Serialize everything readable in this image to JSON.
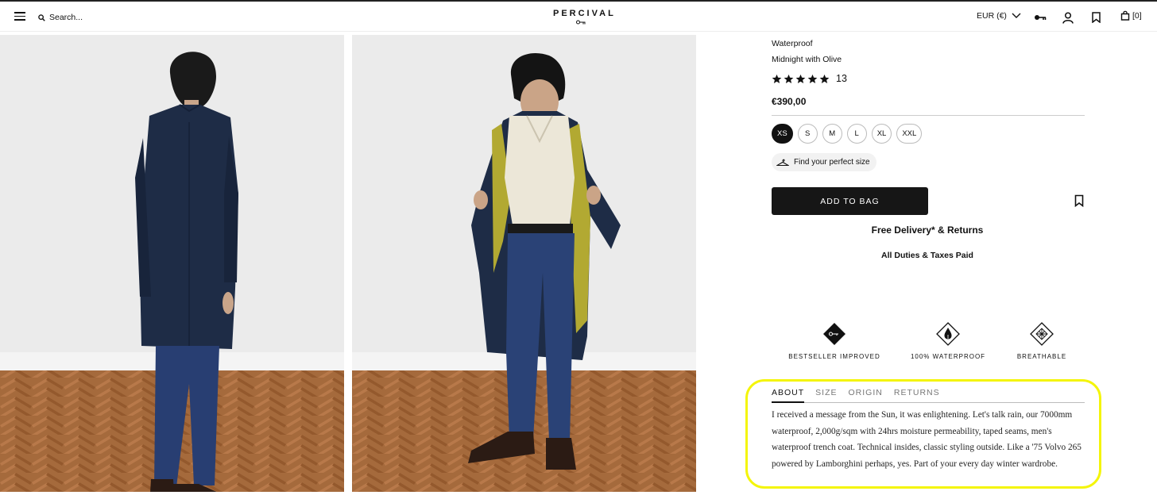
{
  "header": {
    "search_placeholder": "Search...",
    "logo_text": "PERCIVAL",
    "currency": "EUR (€)",
    "bag_count": "[0]",
    "icons": [
      "menu-icon",
      "search-icon",
      "chevron-down-icon",
      "key-icon",
      "account-icon",
      "bookmark-icon",
      "bag-icon"
    ]
  },
  "product": {
    "feature_line": "Waterproof",
    "colour": "Midnight with Olive",
    "rating": 5,
    "review_count": "13",
    "price": "€390,00",
    "sizes": [
      "XS",
      "S",
      "M",
      "L",
      "XL",
      "XXL"
    ],
    "selected_size": "XS",
    "find_size_label": "Find your perfect size",
    "add_to_bag_label": "ADD TO BAG",
    "delivery_text": "Free Delivery* & Returns",
    "duties_text": "All Duties & Taxes Paid"
  },
  "features": [
    {
      "label": "BESTSELLER IMPROVED",
      "icon": "key-diamond-icon"
    },
    {
      "label": "100% WATERPROOF",
      "icon": "raindrop-diamond-icon"
    },
    {
      "label": "BREATHABLE",
      "icon": "mesh-diamond-icon"
    }
  ],
  "tabs": {
    "items": [
      "ABOUT",
      "SIZE",
      "ORIGIN",
      "RETURNS"
    ],
    "active": "ABOUT"
  },
  "about_text": "I received a message from the Sun, it was enlightening. Let's talk rain, our 7000mm waterproof, 2,000g/sqm with 24hrs moisture permeability, taped seams, men's waterproof trench coat. Technical insides, classic styling outside. Like a '75 Volvo 265 powered by Lamborghini perhaps, yes. Part of your every day winter wardrobe.",
  "colors": {
    "highlight": "#f4f50a",
    "coat": "#1d2b45",
    "lining": "#b2a932",
    "floor": "#a5683a"
  }
}
